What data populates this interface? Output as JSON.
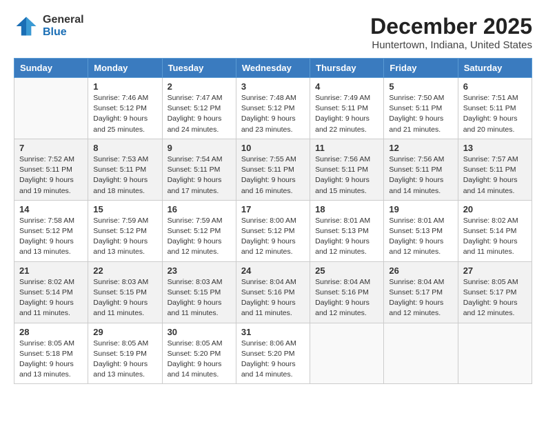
{
  "logo": {
    "general": "General",
    "blue": "Blue"
  },
  "title": "December 2025",
  "location": "Huntertown, Indiana, United States",
  "days_of_week": [
    "Sunday",
    "Monday",
    "Tuesday",
    "Wednesday",
    "Thursday",
    "Friday",
    "Saturday"
  ],
  "weeks": [
    [
      {
        "day": "",
        "sunrise": "",
        "sunset": "",
        "daylight": ""
      },
      {
        "day": "1",
        "sunrise": "Sunrise: 7:46 AM",
        "sunset": "Sunset: 5:12 PM",
        "daylight": "Daylight: 9 hours and 25 minutes."
      },
      {
        "day": "2",
        "sunrise": "Sunrise: 7:47 AM",
        "sunset": "Sunset: 5:12 PM",
        "daylight": "Daylight: 9 hours and 24 minutes."
      },
      {
        "day": "3",
        "sunrise": "Sunrise: 7:48 AM",
        "sunset": "Sunset: 5:12 PM",
        "daylight": "Daylight: 9 hours and 23 minutes."
      },
      {
        "day": "4",
        "sunrise": "Sunrise: 7:49 AM",
        "sunset": "Sunset: 5:11 PM",
        "daylight": "Daylight: 9 hours and 22 minutes."
      },
      {
        "day": "5",
        "sunrise": "Sunrise: 7:50 AM",
        "sunset": "Sunset: 5:11 PM",
        "daylight": "Daylight: 9 hours and 21 minutes."
      },
      {
        "day": "6",
        "sunrise": "Sunrise: 7:51 AM",
        "sunset": "Sunset: 5:11 PM",
        "daylight": "Daylight: 9 hours and 20 minutes."
      }
    ],
    [
      {
        "day": "7",
        "sunrise": "Sunrise: 7:52 AM",
        "sunset": "Sunset: 5:11 PM",
        "daylight": "Daylight: 9 hours and 19 minutes."
      },
      {
        "day": "8",
        "sunrise": "Sunrise: 7:53 AM",
        "sunset": "Sunset: 5:11 PM",
        "daylight": "Daylight: 9 hours and 18 minutes."
      },
      {
        "day": "9",
        "sunrise": "Sunrise: 7:54 AM",
        "sunset": "Sunset: 5:11 PM",
        "daylight": "Daylight: 9 hours and 17 minutes."
      },
      {
        "day": "10",
        "sunrise": "Sunrise: 7:55 AM",
        "sunset": "Sunset: 5:11 PM",
        "daylight": "Daylight: 9 hours and 16 minutes."
      },
      {
        "day": "11",
        "sunrise": "Sunrise: 7:56 AM",
        "sunset": "Sunset: 5:11 PM",
        "daylight": "Daylight: 9 hours and 15 minutes."
      },
      {
        "day": "12",
        "sunrise": "Sunrise: 7:56 AM",
        "sunset": "Sunset: 5:11 PM",
        "daylight": "Daylight: 9 hours and 14 minutes."
      },
      {
        "day": "13",
        "sunrise": "Sunrise: 7:57 AM",
        "sunset": "Sunset: 5:11 PM",
        "daylight": "Daylight: 9 hours and 14 minutes."
      }
    ],
    [
      {
        "day": "14",
        "sunrise": "Sunrise: 7:58 AM",
        "sunset": "Sunset: 5:12 PM",
        "daylight": "Daylight: 9 hours and 13 minutes."
      },
      {
        "day": "15",
        "sunrise": "Sunrise: 7:59 AM",
        "sunset": "Sunset: 5:12 PM",
        "daylight": "Daylight: 9 hours and 13 minutes."
      },
      {
        "day": "16",
        "sunrise": "Sunrise: 7:59 AM",
        "sunset": "Sunset: 5:12 PM",
        "daylight": "Daylight: 9 hours and 12 minutes."
      },
      {
        "day": "17",
        "sunrise": "Sunrise: 8:00 AM",
        "sunset": "Sunset: 5:12 PM",
        "daylight": "Daylight: 9 hours and 12 minutes."
      },
      {
        "day": "18",
        "sunrise": "Sunrise: 8:01 AM",
        "sunset": "Sunset: 5:13 PM",
        "daylight": "Daylight: 9 hours and 12 minutes."
      },
      {
        "day": "19",
        "sunrise": "Sunrise: 8:01 AM",
        "sunset": "Sunset: 5:13 PM",
        "daylight": "Daylight: 9 hours and 12 minutes."
      },
      {
        "day": "20",
        "sunrise": "Sunrise: 8:02 AM",
        "sunset": "Sunset: 5:14 PM",
        "daylight": "Daylight: 9 hours and 11 minutes."
      }
    ],
    [
      {
        "day": "21",
        "sunrise": "Sunrise: 8:02 AM",
        "sunset": "Sunset: 5:14 PM",
        "daylight": "Daylight: 9 hours and 11 minutes."
      },
      {
        "day": "22",
        "sunrise": "Sunrise: 8:03 AM",
        "sunset": "Sunset: 5:15 PM",
        "daylight": "Daylight: 9 hours and 11 minutes."
      },
      {
        "day": "23",
        "sunrise": "Sunrise: 8:03 AM",
        "sunset": "Sunset: 5:15 PM",
        "daylight": "Daylight: 9 hours and 11 minutes."
      },
      {
        "day": "24",
        "sunrise": "Sunrise: 8:04 AM",
        "sunset": "Sunset: 5:16 PM",
        "daylight": "Daylight: 9 hours and 11 minutes."
      },
      {
        "day": "25",
        "sunrise": "Sunrise: 8:04 AM",
        "sunset": "Sunset: 5:16 PM",
        "daylight": "Daylight: 9 hours and 12 minutes."
      },
      {
        "day": "26",
        "sunrise": "Sunrise: 8:04 AM",
        "sunset": "Sunset: 5:17 PM",
        "daylight": "Daylight: 9 hours and 12 minutes."
      },
      {
        "day": "27",
        "sunrise": "Sunrise: 8:05 AM",
        "sunset": "Sunset: 5:17 PM",
        "daylight": "Daylight: 9 hours and 12 minutes."
      }
    ],
    [
      {
        "day": "28",
        "sunrise": "Sunrise: 8:05 AM",
        "sunset": "Sunset: 5:18 PM",
        "daylight": "Daylight: 9 hours and 13 minutes."
      },
      {
        "day": "29",
        "sunrise": "Sunrise: 8:05 AM",
        "sunset": "Sunset: 5:19 PM",
        "daylight": "Daylight: 9 hours and 13 minutes."
      },
      {
        "day": "30",
        "sunrise": "Sunrise: 8:05 AM",
        "sunset": "Sunset: 5:20 PM",
        "daylight": "Daylight: 9 hours and 14 minutes."
      },
      {
        "day": "31",
        "sunrise": "Sunrise: 8:06 AM",
        "sunset": "Sunset: 5:20 PM",
        "daylight": "Daylight: 9 hours and 14 minutes."
      },
      {
        "day": "",
        "sunrise": "",
        "sunset": "",
        "daylight": ""
      },
      {
        "day": "",
        "sunrise": "",
        "sunset": "",
        "daylight": ""
      },
      {
        "day": "",
        "sunrise": "",
        "sunset": "",
        "daylight": ""
      }
    ]
  ]
}
